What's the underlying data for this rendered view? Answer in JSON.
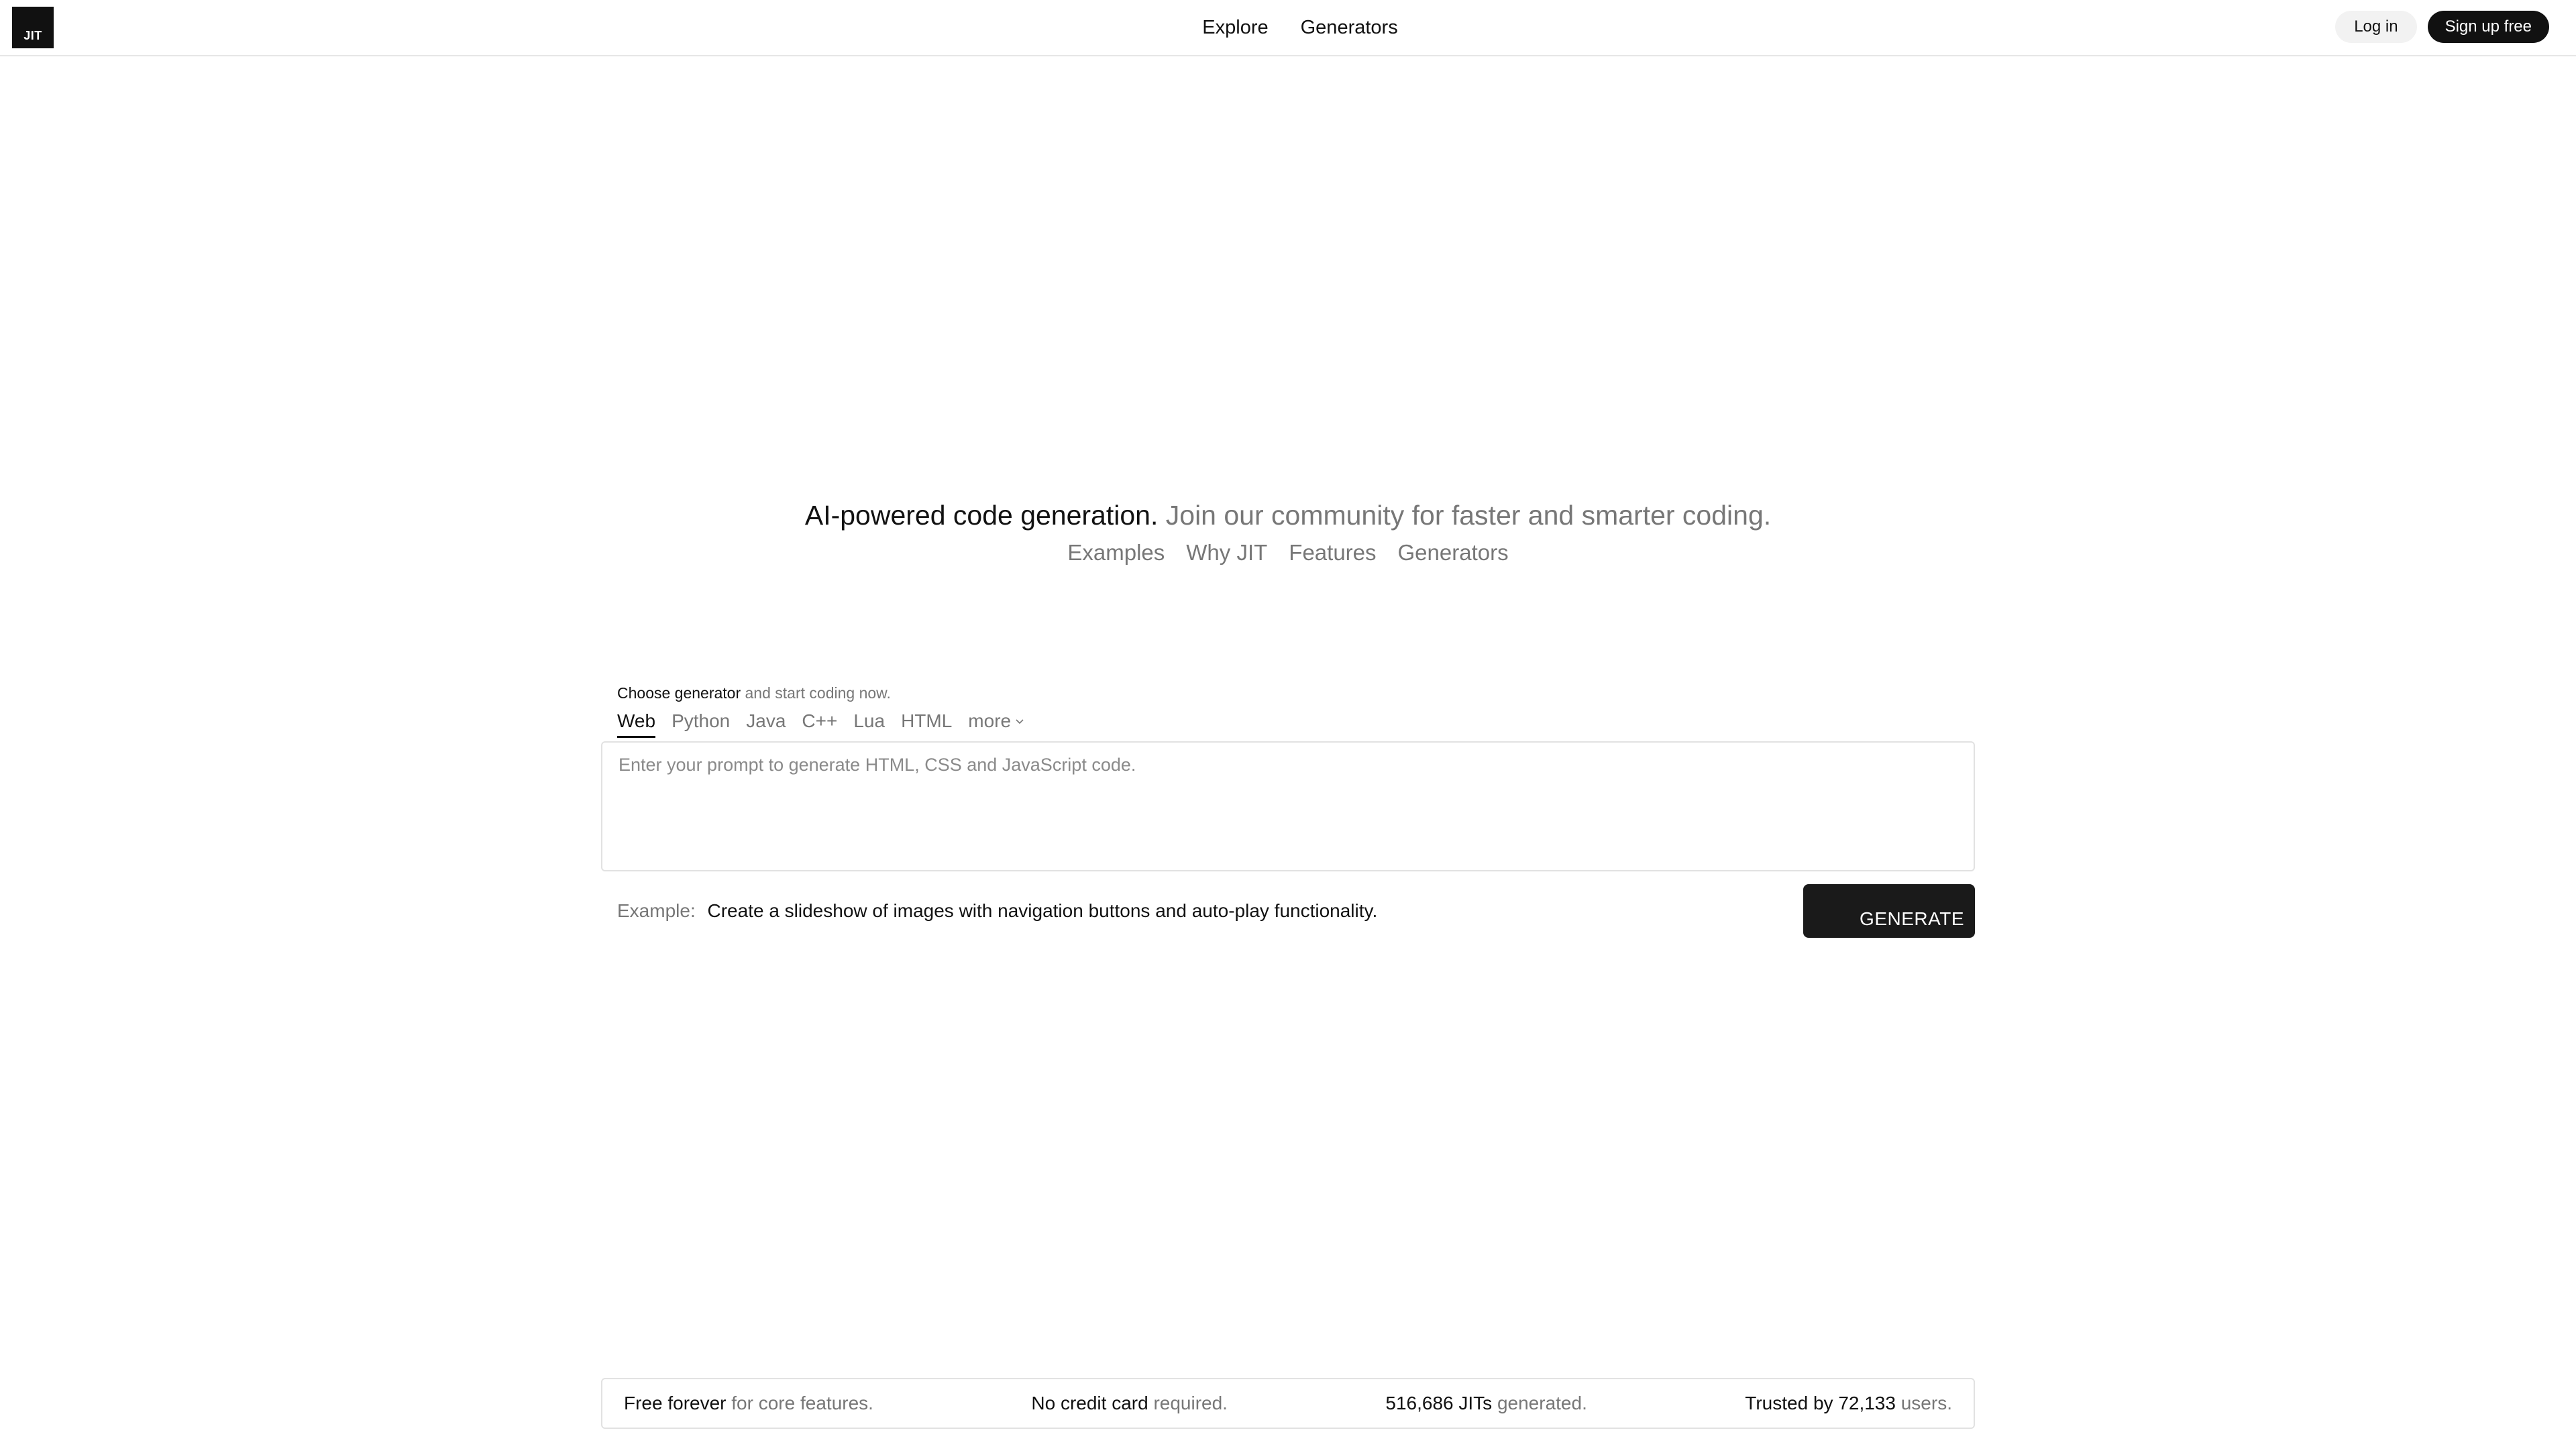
{
  "header": {
    "logo_text": "JIT",
    "nav": {
      "explore": "Explore",
      "generators": "Generators"
    },
    "login": "Log in",
    "signup": "Sign up free"
  },
  "hero": {
    "headline_strong": "AI-powered code generation.",
    "headline_muted": "Join our community for faster and smarter coding.",
    "links": [
      "Examples",
      "Why JIT",
      "Features",
      "Generators"
    ]
  },
  "generator": {
    "choose_strong": "Choose generator",
    "choose_muted": "and start coding now.",
    "tabs": [
      "Web",
      "Python",
      "Java",
      "C++",
      "Lua",
      "HTML",
      "more"
    ],
    "active_tab": "Web",
    "prompt_placeholder": "Enter your prompt to generate HTML, CSS and JavaScript code.",
    "example_label": "Example:",
    "example_text": "Create a slideshow of images with navigation buttons and auto-play functionality.",
    "generate_button": "GENERATE"
  },
  "stats": {
    "free_strong": "Free forever",
    "free_muted": "for core features.",
    "card_strong": "No credit card",
    "card_muted": "required.",
    "jits_strong": "516,686 JITs",
    "jits_muted": "generated.",
    "trusted_strong": "Trusted by 72,133",
    "trusted_muted": "users."
  },
  "icons": {
    "more_tab": "chevron-down-icon"
  },
  "colors": {
    "primary": "#111111",
    "muted": "#777777",
    "border": "#e2e2e2"
  }
}
